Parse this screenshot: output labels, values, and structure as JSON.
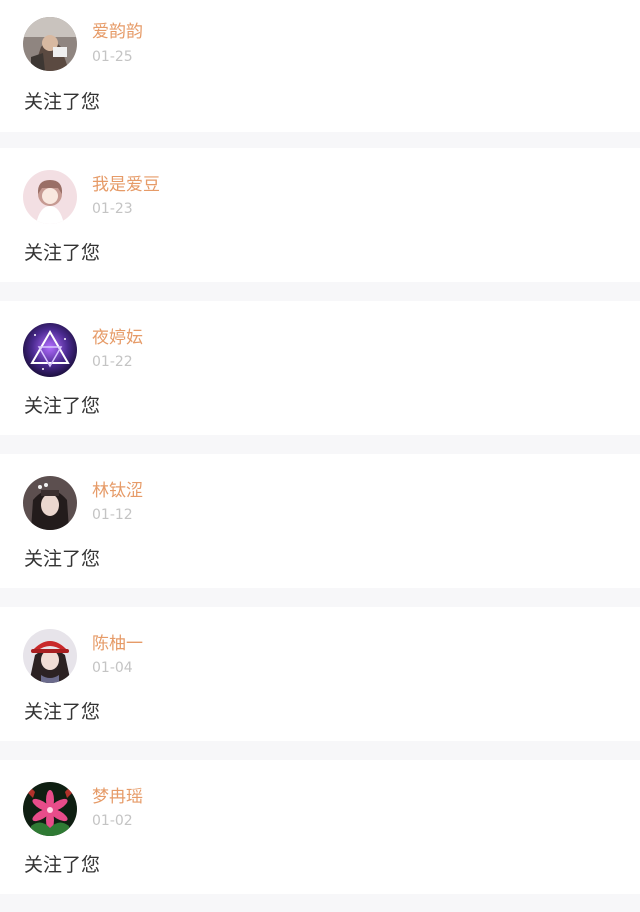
{
  "notifications": [
    {
      "name": "爱韵韵",
      "date": "01-25",
      "message": "关注了您",
      "avatar": "avatar-photo-girl"
    },
    {
      "name": "我是爱豆",
      "date": "01-23",
      "message": "关注了您",
      "avatar": "avatar-anime-girl-pink"
    },
    {
      "name": "夜婷妘",
      "date": "01-22",
      "message": "关注了您",
      "avatar": "avatar-galaxy-triangle"
    },
    {
      "name": "林钛涩",
      "date": "01-12",
      "message": "关注了您",
      "avatar": "avatar-photo-girl-dark"
    },
    {
      "name": "陈柚一",
      "date": "01-04",
      "message": "关注了您",
      "avatar": "avatar-girl-red-hat"
    },
    {
      "name": "梦冉瑶",
      "date": "01-02",
      "message": "关注了您",
      "avatar": "avatar-pink-lily"
    }
  ],
  "colors": {
    "name": "#e69b68",
    "date": "#c4c4c4",
    "message": "#333333",
    "background": "#f7f7f9",
    "card": "#ffffff"
  }
}
